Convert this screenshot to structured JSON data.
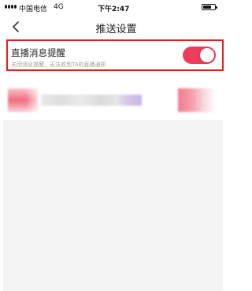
{
  "status_bar": {
    "carrier": "中国电信",
    "network": "4G",
    "time": "下午2:47"
  },
  "nav": {
    "title": "推送设置"
  },
  "setting": {
    "title": "直播消息提醒",
    "description": "关闭消息提醒，无法收到TA的直播通知",
    "toggle_on": true,
    "toggle_color": "#ee3d5a",
    "highlight_color": "#e02020"
  },
  "icons": {
    "back": "chevron-left-icon",
    "battery": "battery-icon",
    "signal": "signal-icon"
  }
}
